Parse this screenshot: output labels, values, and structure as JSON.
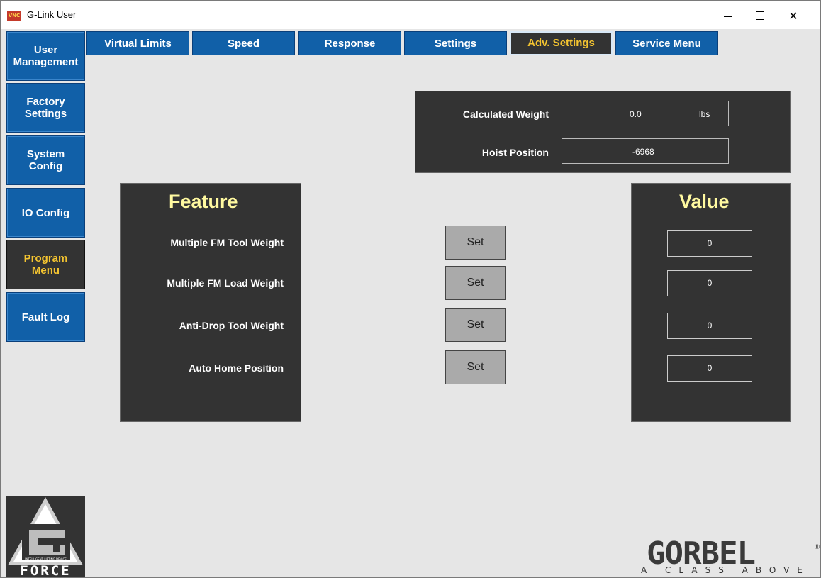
{
  "window": {
    "title": "G-Link User",
    "app_icon_text": "VNC"
  },
  "sidebar": {
    "items": [
      {
        "label": "User\nManagement"
      },
      {
        "label": "Factory\nSettings"
      },
      {
        "label": "System\nConfig"
      },
      {
        "label": "IO Config"
      },
      {
        "label": "Program\nMenu"
      },
      {
        "label": "Fault Log"
      }
    ]
  },
  "tabs": [
    {
      "label": "Virtual Limits"
    },
    {
      "label": "Speed"
    },
    {
      "label": "Response"
    },
    {
      "label": "Settings"
    },
    {
      "label": "Adv. Settings"
    },
    {
      "label": "Service Menu"
    }
  ],
  "info": {
    "calculated_weight_label": "Calculated Weight",
    "calculated_weight_value": "0.0",
    "calculated_weight_unit": "lbs",
    "hoist_position_label": "Hoist Position",
    "hoist_position_value": "-6968"
  },
  "feature_panel": {
    "heading": "Feature",
    "rows": [
      {
        "label": "Multiple FM Tool Weight"
      },
      {
        "label": "Multiple FM Load Weight"
      },
      {
        "label": "Anti-Drop Tool Weight"
      },
      {
        "label": "Auto Home Position"
      }
    ]
  },
  "set_buttons": [
    "Set",
    "Set",
    "Set",
    "Set"
  ],
  "value_panel": {
    "heading": "Value",
    "values": [
      "0",
      "0",
      "0",
      "0"
    ]
  },
  "logos": {
    "gforce_small": "INTELLIGENT LIFTING DEVICE",
    "gforce_word": "FORCE",
    "gorbel_word": "GORBEL",
    "gorbel_tagline": "A CLASS ABOVE",
    "gorbel_registered": "®"
  },
  "colors": {
    "tab_blue": "#1160a8",
    "panel_dark": "#333333",
    "accent_yellow": "#f4c430",
    "heading_yellow": "#fff9a0",
    "background": "#e6e6e6"
  }
}
